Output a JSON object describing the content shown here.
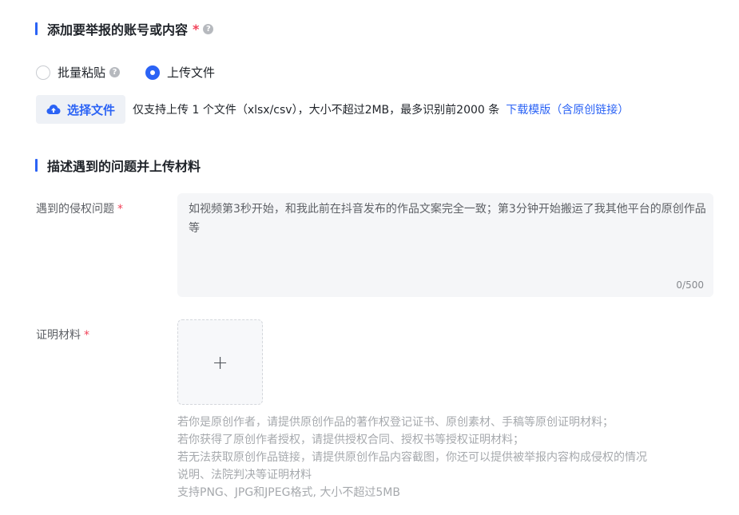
{
  "section1": {
    "title": "添加要举报的账号或内容",
    "required_mark": "*",
    "help": "?"
  },
  "mode": {
    "options": [
      {
        "label": "批量粘贴",
        "checked": false,
        "help": "?"
      },
      {
        "label": "上传文件",
        "checked": true
      }
    ]
  },
  "upload": {
    "button_label": "选择文件",
    "hint": "仅支持上传 1 个文件（xlsx/csv），大小不超过2MB，最多识别前2000 条",
    "link": "下载模版（含原创链接）",
    "icon": "cloud-upload-icon",
    "accent": "#2b63f5"
  },
  "section2": {
    "title": "描述遇到的问题并上传材料"
  },
  "issue": {
    "label": "遇到的侵权问题",
    "required_mark": "*",
    "placeholder": "如视频第3秒开始，和我此前在抖音发布的作品文案完全一致；第3分钟开始搬运了我其他平台的原创作品等",
    "counter": "0/500"
  },
  "evidence": {
    "label": "证明材料",
    "required_mark": "*",
    "add_icon": "+",
    "tips": [
      "若你是原创作者，请提供原创作品的著作权登记证书、原创素材、手稿等原创证明材料；",
      "若你获得了原创作者授权，请提供授权合同、授权书等授权证明材料；",
      "若无法获取原创作品链接，请提供原创作品内容截图，你还可以提供被举报内容构成侵权的情况",
      "说明、法院判决等证明材料",
      "支持PNG、JPG和JPEG格式, 大小不超过5MB"
    ]
  }
}
